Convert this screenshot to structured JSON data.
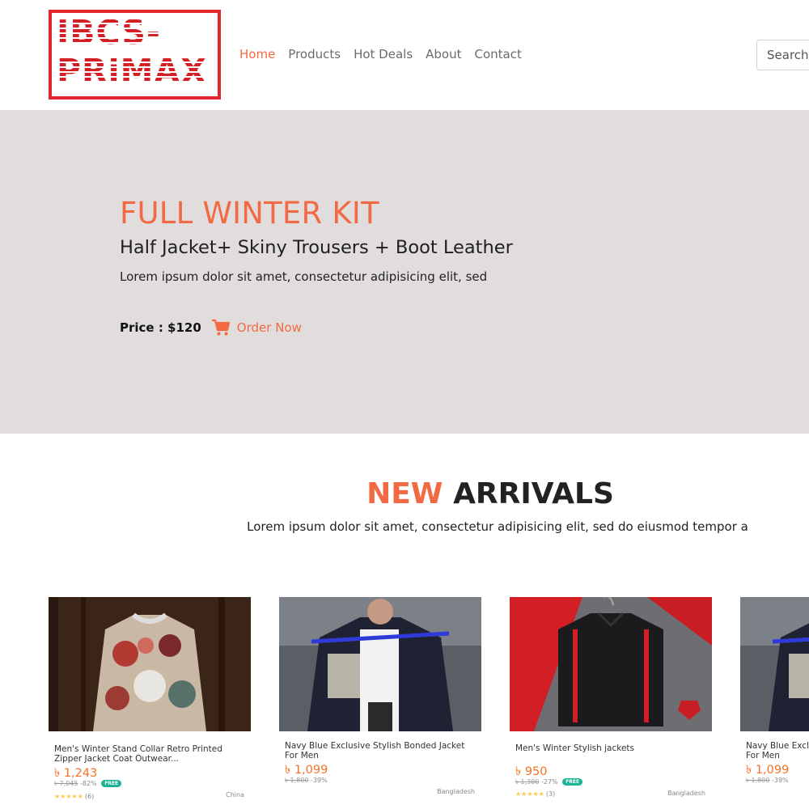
{
  "brand": {
    "line1": "IBCS-",
    "line2": "PRiMAX"
  },
  "nav": [
    {
      "label": "Home",
      "active": true
    },
    {
      "label": "Products"
    },
    {
      "label": "Hot Deals"
    },
    {
      "label": "About"
    },
    {
      "label": "Contact"
    }
  ],
  "search": {
    "placeholder": "Search"
  },
  "hero": {
    "title": "FULL WINTER KIT",
    "subtitle": "Half Jacket+ Skiny Trousers + Boot Leather",
    "text": "Lorem ipsum dolor sit amet, consectetur adipisicing elit, sed",
    "price": "Price : $120",
    "cta": "Order Now"
  },
  "arrivals": {
    "title_accent": "NEW",
    "title_rest": "ARRIVALS",
    "subtitle": "Lorem ipsum dolor sit amet, consectetur adipisicing elit, sed do eiusmod tempor a"
  },
  "products": [
    {
      "name": "Men's Winter Stand Collar Retro Printed Zipper Jacket Coat Outwear...",
      "price": "৳ 1,243",
      "old_price": "৳ 7,045",
      "discount": "-82%",
      "free": "FREE",
      "rating_count": "(6)",
      "origin": "China",
      "stars": "★★★★★"
    },
    {
      "name": "Navy Blue Exclusive Stylish Bonded Jacket For Men",
      "price": "৳ 1,099",
      "old_price": "৳ 1,800",
      "discount": "-39%",
      "free": "",
      "rating_count": "",
      "origin": "Bangladesh",
      "stars": ""
    },
    {
      "name": "Men's Winter Stylish jackets",
      "price": "৳ 950",
      "old_price": "৳ 1,300",
      "discount": "-27%",
      "free": "FREE",
      "rating_count": "(3)",
      "origin": "Bangladesh",
      "stars": "★★★★★"
    },
    {
      "name": "Navy Blue Exclusive Stylish Bonded Jacket For Men",
      "price": "৳ 1,099",
      "old_price": "৳ 1,800",
      "discount": "-39%",
      "free": "",
      "rating_count": "",
      "origin": "",
      "stars": ""
    }
  ],
  "colors": {
    "accent": "#f26a43",
    "hero_bg": "#e1dddd",
    "logo_red": "#e3262d",
    "price_orange": "#f57224",
    "free_badge": "#1bb394"
  }
}
